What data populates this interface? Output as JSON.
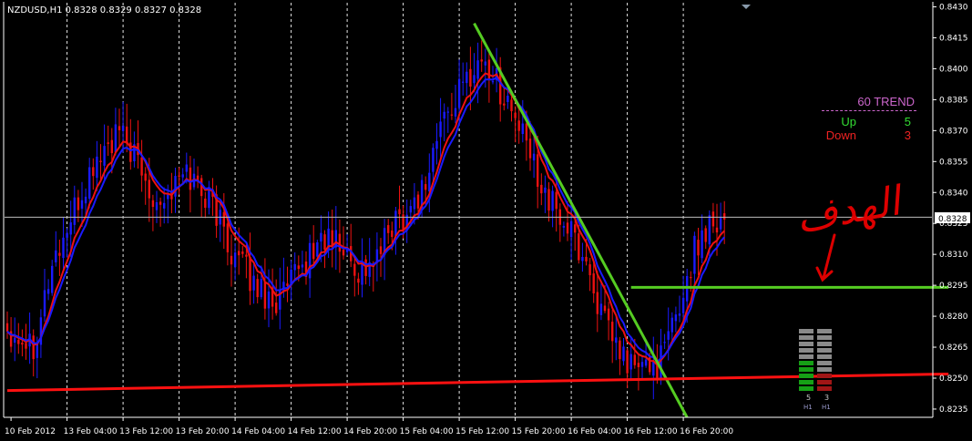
{
  "header": {
    "title": "NZDUSD,H1  0.8328 0.8329 0.8327 0.8328"
  },
  "trend_panel": {
    "title": "60 TREND",
    "up_label": "Up",
    "up_value": "5",
    "down_label": "Down",
    "down_value": "3"
  },
  "strength_meter": {
    "up_count": "5",
    "down_count": "3",
    "timeframe_up": "H1",
    "timeframe_down": "H1",
    "bars_total": 10,
    "up_active": 5,
    "down_active": 3
  },
  "colors": {
    "background": "#000000",
    "bull": "#1a1aff",
    "bear": "#ee1111",
    "fast_line": "#1a1aff",
    "slow_line": "#ee1111",
    "trendline": "#55cc22",
    "support_line": "#ff1111",
    "grid": "#ffffff",
    "axis_text": "#ffffff"
  },
  "chart_data": {
    "type": "candlestick",
    "symbol": "NZDUSD",
    "timeframe": "H1",
    "current_price": "0.8328",
    "y_ticks": [
      "0.8430",
      "0.8415",
      "0.8400",
      "0.8385",
      "0.8370",
      "0.8355",
      "0.8340",
      "0.8325",
      "0.8310",
      "0.8295",
      "0.8280",
      "0.8265",
      "0.8250",
      "0.8235"
    ],
    "ylim": [
      0.8231,
      0.8432
    ],
    "x_ticks": [
      "10 Feb 2012",
      "13 Feb 04:00",
      "13 Feb 12:00",
      "13 Feb 20:00",
      "14 Feb 04:00",
      "14 Feb 12:00",
      "14 Feb 20:00",
      "15 Feb 04:00",
      "15 Feb 12:00",
      "15 Feb 20:00",
      "16 Feb 04:00",
      "16 Feb 12:00",
      "16 Feb 20:00"
    ],
    "anchors": [
      [
        0,
        0.8274
      ],
      [
        7,
        0.8267
      ],
      [
        12,
        0.8305
      ],
      [
        18,
        0.833
      ],
      [
        24,
        0.8356
      ],
      [
        30,
        0.8368
      ],
      [
        33,
        0.8361
      ],
      [
        38,
        0.8341
      ],
      [
        42,
        0.8337
      ],
      [
        48,
        0.835
      ],
      [
        55,
        0.8335
      ],
      [
        60,
        0.8312
      ],
      [
        66,
        0.8296
      ],
      [
        72,
        0.8287
      ],
      [
        78,
        0.83
      ],
      [
        84,
        0.8318
      ],
      [
        88,
        0.8316
      ],
      [
        94,
        0.8302
      ],
      [
        99,
        0.8307
      ],
      [
        103,
        0.8325
      ],
      [
        108,
        0.8333
      ],
      [
        112,
        0.8345
      ],
      [
        116,
        0.8373
      ],
      [
        120,
        0.8385
      ],
      [
        124,
        0.8398
      ],
      [
        127,
        0.8405
      ],
      [
        130,
        0.8397
      ],
      [
        135,
        0.838
      ],
      [
        140,
        0.8358
      ],
      [
        146,
        0.8333
      ],
      [
        150,
        0.8323
      ],
      [
        155,
        0.8306
      ],
      [
        160,
        0.8275
      ],
      [
        165,
        0.8259
      ],
      [
        170,
        0.8254
      ],
      [
        175,
        0.8259
      ],
      [
        180,
        0.8285
      ],
      [
        184,
        0.8312
      ],
      [
        188,
        0.8327
      ],
      [
        192,
        0.8328
      ]
    ],
    "candle_count": 193,
    "trendline": {
      "start": [
        125,
        0.8422
      ],
      "end": [
        182,
        0.8231
      ]
    },
    "support_line": {
      "start": [
        0,
        0.8244
      ],
      "end": [
        252,
        0.8252
      ]
    },
    "resistance_line": {
      "start": [
        167,
        0.8294
      ],
      "end": [
        252,
        0.8294
      ]
    }
  },
  "annotation": {
    "text": "الهدف"
  }
}
